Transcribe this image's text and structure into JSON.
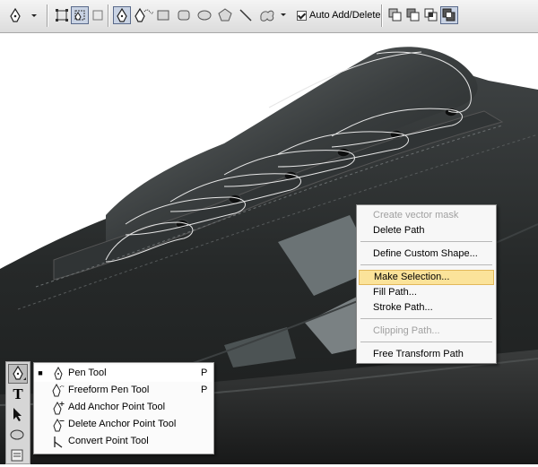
{
  "options_bar": {
    "tool_icon": "pen-icon",
    "mode_icons": [
      "shape-layers-icon",
      "paths-icon",
      "fill-pixels-icon"
    ],
    "pen_icons": [
      "pen-icon",
      "freeform-pen-icon"
    ],
    "shape_icons": [
      "rectangle-icon",
      "rounded-rectangle-icon",
      "ellipse-icon",
      "polygon-icon",
      "line-icon",
      "custom-shape-icon"
    ],
    "auto_add_delete": {
      "label": "Auto Add/Delete",
      "checked": true
    },
    "path_op_icons": [
      "add-to-area-icon",
      "subtract-from-area-icon",
      "intersect-areas-icon",
      "exclude-overlap-icon"
    ]
  },
  "context_menu": {
    "items": [
      {
        "label": "Create vector mask",
        "disabled": true
      },
      {
        "label": "Delete Path"
      },
      {
        "separator": true
      },
      {
        "label": "Define Custom Shape..."
      },
      {
        "separator": true
      },
      {
        "label": "Make Selection...",
        "highlighted": true
      },
      {
        "label": "Fill Path..."
      },
      {
        "label": "Stroke Path..."
      },
      {
        "separator": true
      },
      {
        "label": "Clipping Path...",
        "disabled": true
      },
      {
        "separator": true
      },
      {
        "label": "Free Transform Path"
      }
    ]
  },
  "toolbar": {
    "tools": [
      "pen-tool-icon",
      "type-tool-icon",
      "path-selection-icon",
      "ellipse-tool-icon",
      "notes-icon"
    ],
    "type_glyph": "T"
  },
  "tool_flyout": {
    "items": [
      {
        "label": "Pen Tool",
        "shortcut": "P",
        "selected": true,
        "marker": "■"
      },
      {
        "label": "Freeform Pen Tool",
        "shortcut": "P"
      },
      {
        "label": "Add Anchor Point Tool",
        "shortcut": ""
      },
      {
        "label": "Delete Anchor Point Tool",
        "shortcut": ""
      },
      {
        "label": "Convert Point Tool",
        "shortcut": ""
      }
    ]
  },
  "colors": {
    "menu_highlight": "#fbe39a",
    "shoe_body": "#2a2d2e",
    "toolbar_bg": "#d6d6d6"
  }
}
